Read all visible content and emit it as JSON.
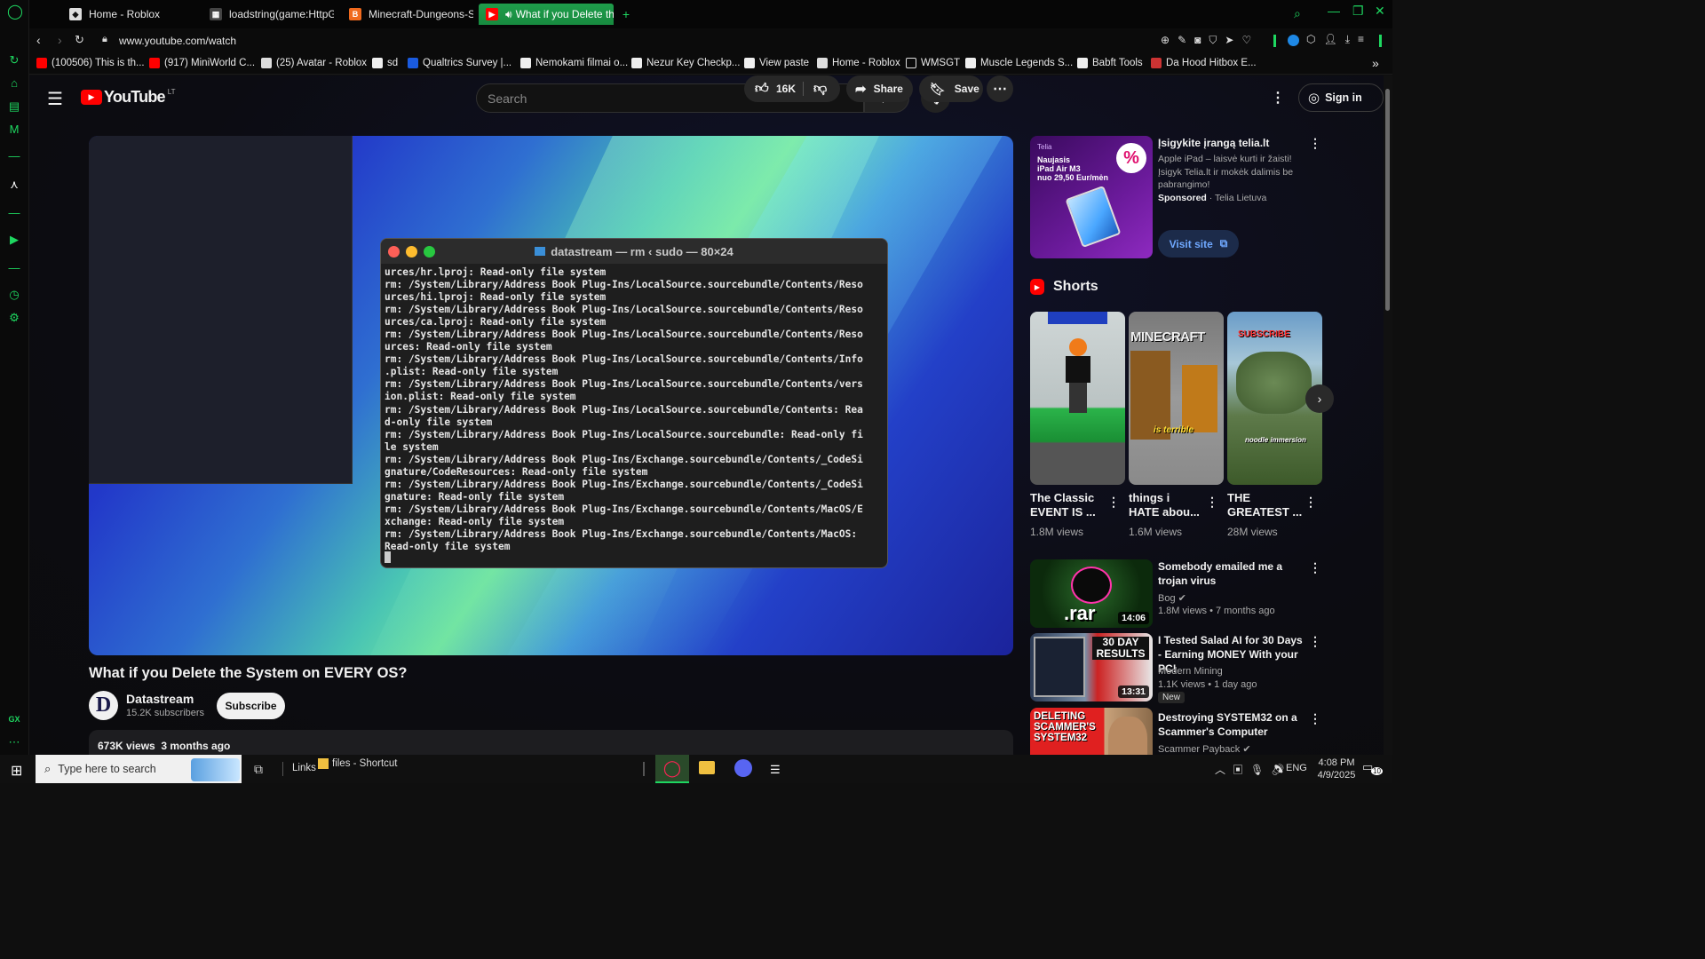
{
  "browser": {
    "tabs": [
      {
        "label": "Home - Roblox"
      },
      {
        "label": "loadstring(game:HttpGet("
      },
      {
        "label": "Minecraft-Dungeons-Ste"
      },
      {
        "label": "What if you Delete the"
      }
    ],
    "url": "www.youtube.com/watch",
    "bookmarks": [
      {
        "label": "(100506) This is th..."
      },
      {
        "label": "(917) MiniWorld C..."
      },
      {
        "label": "(25) Avatar - Roblox"
      },
      {
        "label": "sd"
      },
      {
        "label": "Qualtrics Survey |..."
      },
      {
        "label": "Nemokami filmai o..."
      },
      {
        "label": "Nezur Key Checkp..."
      },
      {
        "label": "View paste"
      },
      {
        "label": "Home - Roblox"
      },
      {
        "label": "WMSGT"
      },
      {
        "label": "Muscle Legends S..."
      },
      {
        "label": "Babft Tools"
      },
      {
        "label": "Da Hood Hitbox E..."
      }
    ],
    "sidebar_label": "GX"
  },
  "youtube": {
    "logo_text": "YouTube",
    "region": "LT",
    "search_placeholder": "Search",
    "sign_in": "Sign in",
    "video": {
      "terminal_title": "datastream — rm ‹ sudo — 80×24",
      "terminal_text": "urces/hr.lproj: Read-only file system\nrm: /System/Library/Address Book Plug-Ins/LocalSource.sourcebundle/Contents/Reso\nurces/hi.lproj: Read-only file system\nrm: /System/Library/Address Book Plug-Ins/LocalSource.sourcebundle/Contents/Reso\nurces/ca.lproj: Read-only file system\nrm: /System/Library/Address Book Plug-Ins/LocalSource.sourcebundle/Contents/Reso\nurces: Read-only file system\nrm: /System/Library/Address Book Plug-Ins/LocalSource.sourcebundle/Contents/Info\n.plist: Read-only file system\nrm: /System/Library/Address Book Plug-Ins/LocalSource.sourcebundle/Contents/vers\nion.plist: Read-only file system\nrm: /System/Library/Address Book Plug-Ins/LocalSource.sourcebundle/Contents: Rea\nd-only file system\nrm: /System/Library/Address Book Plug-Ins/LocalSource.sourcebundle: Read-only fi\nle system\nrm: /System/Library/Address Book Plug-Ins/Exchange.sourcebundle/Contents/_CodeSi\ngnature/CodeResources: Read-only file system\nrm: /System/Library/Address Book Plug-Ins/Exchange.sourcebundle/Contents/_CodeSi\ngnature: Read-only file system\nrm: /System/Library/Address Book Plug-Ins/Exchange.sourcebundle/Contents/MacOS/E\nxchange: Read-only file system\nrm: /System/Library/Address Book Plug-Ins/Exchange.sourcebundle/Contents/MacOS:\nRead-only file system",
      "title": "What if you Delete the System on EVERY OS?",
      "channel": "Datastream",
      "channel_initial": "D",
      "subscribers": "15.2K subscribers",
      "subscribe": "Subscribe",
      "likes": "16K",
      "share": "Share",
      "save": "Save",
      "views_date": "673K views  3 months ago"
    },
    "ad": {
      "title": "Įsigykite įrangą telia.lt",
      "body": "Apple iPad – laisvė kurti ir žaisti! Įsigyk Telia.lt ir mokėk dalimis be pabrangimo!",
      "sponsored": "Sponsored",
      "advertiser": "· Telia Lietuva",
      "cta": "Visit site",
      "thumb_brand": "Telia",
      "thumb_line1": "Naujasis",
      "thumb_line2": "iPad Air M3",
      "thumb_line3": "nuo 29,50 Eur/mėn",
      "thumb_badge": "%"
    },
    "shorts": {
      "heading": "Shorts",
      "items": [
        {
          "title_l1": "The Classic",
          "title_l2": "EVENT IS ...",
          "views": "1.8M views"
        },
        {
          "title_l1": "things i",
          "title_l2": "HATE abou...",
          "views": "1.6M views"
        },
        {
          "title_l1": "THE",
          "title_l2": "GREATEST ...",
          "views": "28M views"
        }
      ],
      "thumb_text_2a": "MINECRAFT",
      "thumb_text_2b": "is terrible",
      "thumb_text_3a": "SUBSCRIBE",
      "thumb_text_3b": "noodle immersion"
    },
    "recommended": [
      {
        "title": "Somebody emailed me a trojan virus",
        "channel": "Bog",
        "meta": "1.8M views • 7 months ago",
        "duration": "14:06",
        "thumb_text": ".rar"
      },
      {
        "title": "I Tested Salad AI for 30 Days - Earning MONEY With your PC!",
        "channel": "Modern Mining",
        "meta": "1.1K views • 1 day ago",
        "badge": "New",
        "duration": "13:31",
        "thumb_text": "30 DAY RESULTS"
      },
      {
        "title": "Destroying SYSTEM32 on a Scammer's Computer",
        "channel": "Scammer Payback",
        "thumb_text": "DELETING SCAMMER'S SYSTEM32"
      }
    ]
  },
  "taskbar": {
    "search_placeholder": "Type here to search",
    "links_label": "Links",
    "shortcut_label": "files - Shortcut",
    "lang": "ENG",
    "time": "4:08 PM",
    "date": "4/9/2025",
    "notif_count": "10"
  },
  "colors": {
    "accent": "#1ed760",
    "yt_red": "#ff0000",
    "bg": "#0f0f0f"
  }
}
